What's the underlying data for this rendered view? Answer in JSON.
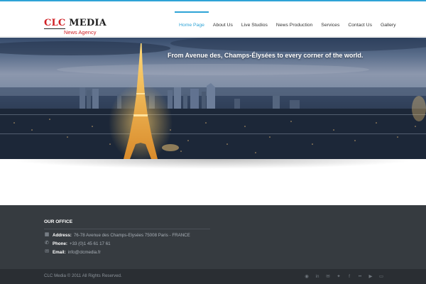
{
  "brand": {
    "logo_clc": "CLC",
    "logo_media": " MEDIA",
    "tagline": "News Agency"
  },
  "nav": {
    "items": [
      "Home Page",
      "About Us",
      "Live Studios",
      "News Production",
      "Services",
      "Contact Us",
      "Gallery"
    ],
    "active_index": 0
  },
  "hero": {
    "caption": "From Avenue des, Champs-Élysées to every corner of the world."
  },
  "footer": {
    "heading": "OUR OFFICE",
    "address_label": "Address:",
    "address_value": "76-78 Avenue des Champs-Elysées 75008 Paris - FRANCE",
    "phone_label": "Phone:",
    "phone_value": "+33 (0)1 45 61 17 61",
    "email_label": "Email:",
    "email_value": "info@clcmedia.fr",
    "copyright": "CLC Media © 2011 All Rights Reserved."
  },
  "social": [
    "rss-icon",
    "linkedin-icon",
    "email-icon",
    "twitter-icon",
    "facebook-icon",
    "flickr-icon",
    "youtube-icon",
    "message-icon"
  ],
  "colors": {
    "accent": "#2ea3d6",
    "brand_red": "#d01f24",
    "footer_bg": "#363b40",
    "bottom_bar_bg": "#2a2e33"
  }
}
